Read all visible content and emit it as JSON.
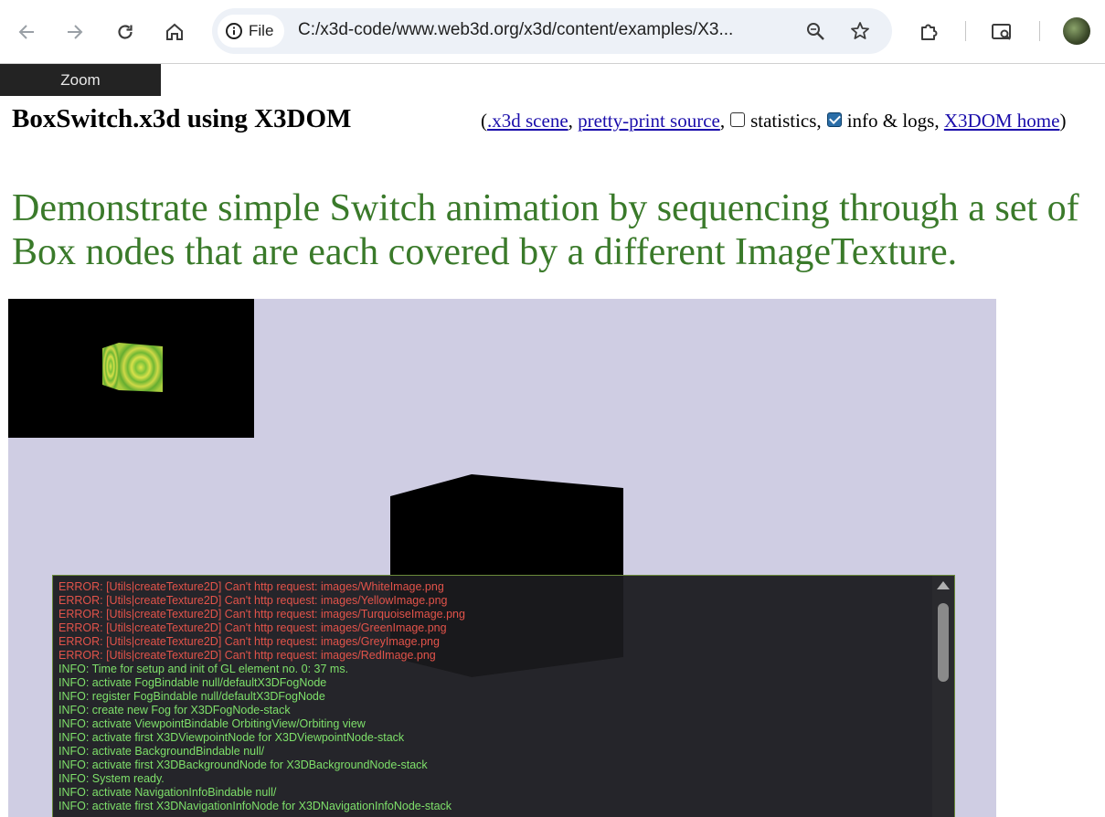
{
  "browser": {
    "file_chip": "File",
    "url": "C:/x3d-code/www.web3d.org/x3d/content/examples/X3..."
  },
  "zoom_label": "Zoom",
  "page": {
    "title": "BoxSwitch.x3d using X3DOM",
    "open_paren": "(",
    "link_scene": ".x3d scene",
    "comma1": ",",
    "link_source": "pretty-print source",
    "comma2": ",",
    "statistics_label": "statistics,",
    "info_label": "info & logs,",
    "link_home": "X3DOM home",
    "close_paren": ")",
    "description": "Demonstrate simple Switch animation by sequencing through a set of Box nodes that are each covered by a different ImageTexture."
  },
  "checkboxes": {
    "statistics": false,
    "info_logs": true
  },
  "log": {
    "lines": [
      {
        "level": "error",
        "text": "ERROR: [Utils|createTexture2D] Can't http request: images/WhiteImage.png"
      },
      {
        "level": "error",
        "text": "ERROR: [Utils|createTexture2D] Can't http request: images/YellowImage.png"
      },
      {
        "level": "error",
        "text": "ERROR: [Utils|createTexture2D] Can't http request: images/TurquoiseImage.png"
      },
      {
        "level": "error",
        "text": "ERROR: [Utils|createTexture2D] Can't http request: images/GreenImage.png"
      },
      {
        "level": "error",
        "text": "ERROR: [Utils|createTexture2D] Can't http request: images/GreyImage.png"
      },
      {
        "level": "error",
        "text": "ERROR: [Utils|createTexture2D] Can't http request: images/RedImage.png"
      },
      {
        "level": "info",
        "text": "INFO: Time for setup and init of GL element no. 0: 37 ms."
      },
      {
        "level": "info",
        "text": "INFO: activate FogBindable null/defaultX3DFogNode"
      },
      {
        "level": "info",
        "text": "INFO: register FogBindable null/defaultX3DFogNode"
      },
      {
        "level": "info",
        "text": "INFO: create new Fog for X3DFogNode-stack"
      },
      {
        "level": "info",
        "text": "INFO: activate ViewpointBindable OrbitingView/Orbiting view"
      },
      {
        "level": "info",
        "text": "INFO: activate first X3DViewpointNode for X3DViewpointNode-stack"
      },
      {
        "level": "info",
        "text": "INFO: activate BackgroundBindable null/"
      },
      {
        "level": "info",
        "text": "INFO: activate first X3DBackgroundNode for X3DBackgroundNode-stack"
      },
      {
        "level": "info",
        "text": "INFO: System ready."
      },
      {
        "level": "info",
        "text": "INFO: activate NavigationInfoBindable null/"
      },
      {
        "level": "info",
        "text": "INFO: activate first X3DNavigationInfoNode for X3DNavigationInfoNode-stack"
      }
    ]
  },
  "colors": {
    "description": "#3a7a2a",
    "canvas_bg": "#cfcde3",
    "error": "#e2534a",
    "info": "#7ee06a"
  }
}
